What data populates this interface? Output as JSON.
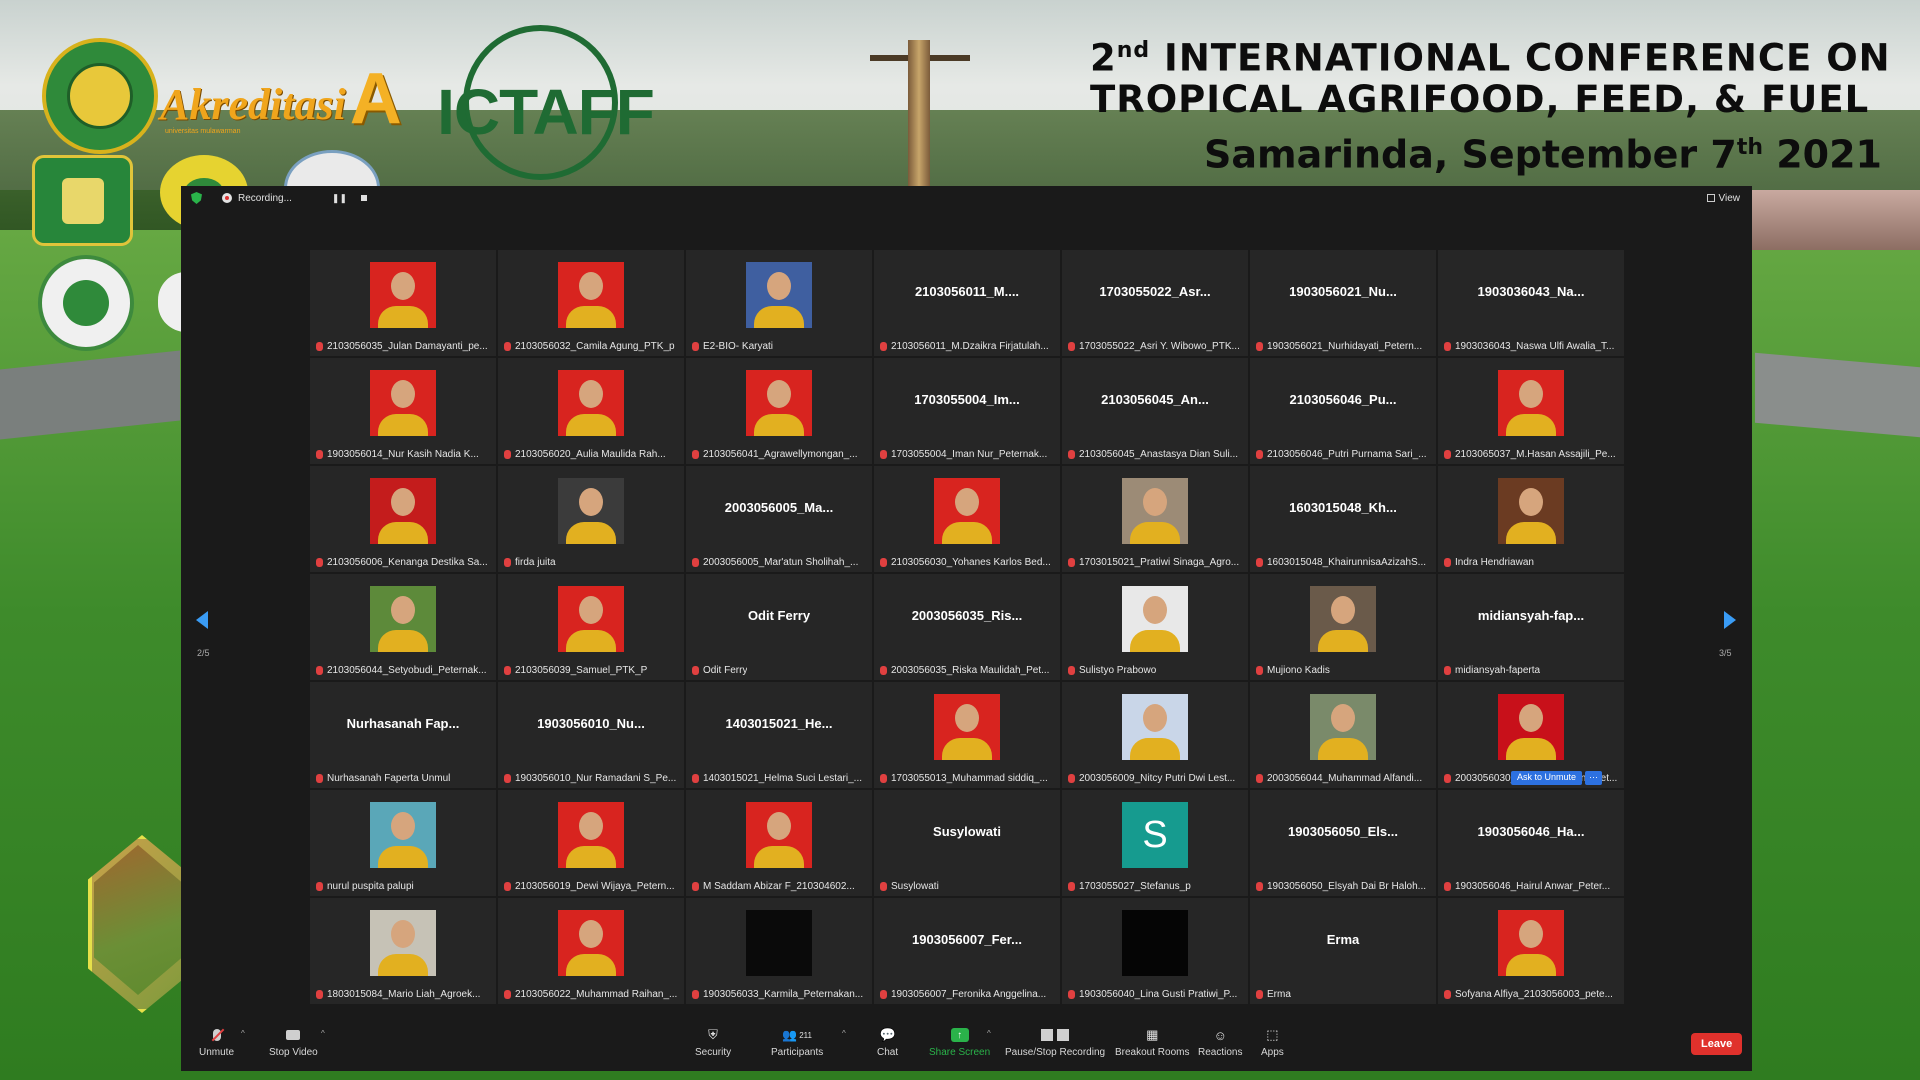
{
  "banner": {
    "accreditation_text": "Akreditasi",
    "accreditation_grade": "A",
    "accreditation_sub": "universitas mulawarman",
    "logo_name": "ICTAFF",
    "conf_line1_pre": "2",
    "conf_line1_sup": "nd",
    "conf_line1_post": " INTERNATIONAL CONFERENCE ON",
    "conf_line2": "TROPICAL AGRIFOOD, FEED, & FUEL",
    "conf_line3_pre": "Samarinda, September 7",
    "conf_line3_sup": "th",
    "conf_line3_post": " 2021"
  },
  "topbar": {
    "recording_label": "Recording...",
    "pause_glyph": "❚❚",
    "view_label": "View"
  },
  "nav": {
    "left_page": "2/5",
    "right_page": "3/5"
  },
  "tiles": [
    {
      "type": "photo",
      "bg": "#d8241f",
      "label": "2103056035_Julan Damayanti_pe..."
    },
    {
      "type": "photo",
      "bg": "#d8241f",
      "label": "2103056032_Camila Agung_PTK_p"
    },
    {
      "type": "photo",
      "bg": "#3f5fa0",
      "label": "E2-BIO- Karyati"
    },
    {
      "type": "name",
      "name": "2103056011_M....",
      "label": "2103056011_M.Dzaikra Firjatulah..."
    },
    {
      "type": "name",
      "name": "1703055022_Asr...",
      "label": "1703055022_Asri Y. Wibowo_PTK..."
    },
    {
      "type": "name",
      "name": "1903056021_Nu...",
      "label": "1903056021_Nurhidayati_Petern..."
    },
    {
      "type": "name",
      "name": "1903036043_Na...",
      "label": "1903036043_Naswa Ulfi Awalia_T..."
    },
    {
      "type": "photo",
      "bg": "#d8241f",
      "label": "1903056014_Nur Kasih Nadia K..."
    },
    {
      "type": "photo",
      "bg": "#d8241f",
      "label": "2103056020_Aulia Maulida Rah..."
    },
    {
      "type": "photo",
      "bg": "#d8241f",
      "label": "2103056041_Agrawellymongan_..."
    },
    {
      "type": "name",
      "name": "1703055004_Im...",
      "label": "1703055004_Iman Nur_Peternak..."
    },
    {
      "type": "name",
      "name": "2103056045_An...",
      "label": "2103056045_Anastasya Dian Suli..."
    },
    {
      "type": "name",
      "name": "2103056046_Pu...",
      "label": "2103056046_Putri Purnama Sari_..."
    },
    {
      "type": "photo",
      "bg": "#d8241f",
      "label": "2103065037_M.Hasan Assajili_Pe..."
    },
    {
      "type": "photo",
      "bg": "#c41c1c",
      "label": "2103056006_Kenanga Destika Sa..."
    },
    {
      "type": "photo",
      "bg": "#3b3b3b",
      "label": "firda juita"
    },
    {
      "type": "name",
      "name": "2003056005_Ma...",
      "label": "2003056005_Mar'atun Sholihah_..."
    },
    {
      "type": "photo",
      "bg": "#d8241f",
      "label": "2103056030_Yohanes Karlos Bed..."
    },
    {
      "type": "photo",
      "bg": "#9c8b76",
      "label": "1703015021_Pratiwi Sinaga_Agro..."
    },
    {
      "type": "name",
      "name": "1603015048_Kh...",
      "label": "1603015048_KhairunnisaAzizahS..."
    },
    {
      "type": "photo",
      "bg": "#6b3b22",
      "label": "Indra Hendriawan"
    },
    {
      "type": "photo",
      "bg": "#5d8a3a",
      "label": "2103056044_Setyobudi_Peternak..."
    },
    {
      "type": "photo",
      "bg": "#d8241f",
      "label": "2103056039_Samuel_PTK_P"
    },
    {
      "type": "name",
      "name": "Odit Ferry",
      "label": "Odit Ferry"
    },
    {
      "type": "name",
      "name": "2003056035_Ris...",
      "label": "2003056035_Riska Maulidah_Pet..."
    },
    {
      "type": "photo",
      "bg": "#e8e8e8",
      "label": "Sulistyo Prabowo"
    },
    {
      "type": "photo",
      "bg": "#6a5a4a",
      "label": "Mujiono Kadis"
    },
    {
      "type": "name",
      "name": "midiansyah-fap...",
      "label": "midiansyah-faperta"
    },
    {
      "type": "name",
      "name": "Nurhasanah Fap...",
      "label": "Nurhasanah Faperta Unmul"
    },
    {
      "type": "name",
      "name": "1903056010_Nu...",
      "label": "1903056010_Nur Ramadani S_Pe..."
    },
    {
      "type": "name",
      "name": "1403015021_He...",
      "label": "1403015021_Helma Suci Lestari_..."
    },
    {
      "type": "photo",
      "bg": "#d8241f",
      "label": "1703055013_Muhammad siddiq_..."
    },
    {
      "type": "photo",
      "bg": "#c9d6e8",
      "label": "2003056009_Nitcy Putri Dwi Lest..."
    },
    {
      "type": "photo",
      "bg": "#7a8a6a",
      "label": "2003056044_Muhammad Alfandi..."
    },
    {
      "type": "photo",
      "bg": "#c8101a",
      "label": "2003056030_Fitriyah Cahyani_Pet...",
      "ask_unmute": true
    },
    {
      "type": "photo",
      "bg": "#5aa7b8",
      "label": "nurul puspita palupi"
    },
    {
      "type": "photo",
      "bg": "#d8241f",
      "label": "2103056019_Dewi Wijaya_Petern..."
    },
    {
      "type": "photo",
      "bg": "#d8241f",
      "label": "M Saddam Abizar F_210304602..."
    },
    {
      "type": "name",
      "name": "Susylowati",
      "label": "Susylowati"
    },
    {
      "type": "letter",
      "letter": "S",
      "bg": "#169b8f",
      "label": "1703055027_Stefanus_p"
    },
    {
      "type": "name",
      "name": "1903056050_Els...",
      "label": "1903056050_Elsyah Dai Br Haloh..."
    },
    {
      "type": "name",
      "name": "1903056046_Ha...",
      "label": "1903056046_Hairul Anwar_Peter..."
    },
    {
      "type": "photo",
      "bg": "#c6c2b6",
      "label": "1803015084_Mario Liah_Agroek..."
    },
    {
      "type": "photo",
      "bg": "#d8241f",
      "label": "2103056022_Muhammad Raihan_..."
    },
    {
      "type": "photo",
      "bg": "#0a0a0a",
      "label": "1903056033_Karmila_Peternakan..."
    },
    {
      "type": "name",
      "name": "1903056007_Fer...",
      "label": "1903056007_Feronika Anggelina..."
    },
    {
      "type": "photo",
      "bg": "#050505",
      "label": "1903056040_Lina Gusti Pratiwi_P..."
    },
    {
      "type": "name",
      "name": "Erma",
      "label": "Erma"
    },
    {
      "type": "photo",
      "bg": "#d8241f",
      "label": "Sofyana Alfiya_2103056003_pete..."
    }
  ],
  "ask_unmute": {
    "label": "Ask to Unmute",
    "more": "···"
  },
  "toolbar": {
    "unmute": "Unmute",
    "stop_video": "Stop Video",
    "security": "Security",
    "participants": "Participants",
    "participants_count": "211",
    "chat": "Chat",
    "share_screen": "Share Screen",
    "pause_stop_recording": "Pause/Stop Recording",
    "breakout_rooms": "Breakout Rooms",
    "reactions": "Reactions",
    "apps": "Apps",
    "leave": "Leave"
  },
  "colors": {
    "accent_green": "#2ab34a",
    "leave_red": "#e0312c",
    "nav_blue": "#3a9cf5"
  }
}
